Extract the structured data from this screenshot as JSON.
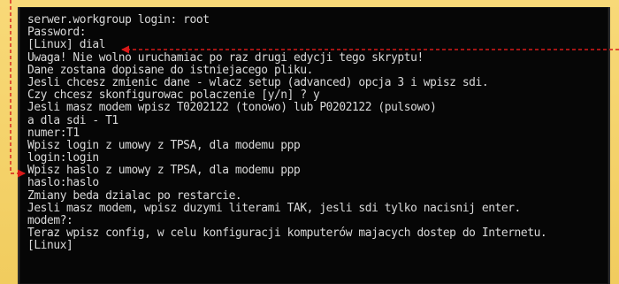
{
  "terminal": {
    "lines": [
      "serwer.workgroup login: root",
      "Password:",
      "[Linux] dial",
      "Uwaga! Nie wolno uruchamiac po raz drugi edycji tego skryptu!",
      "Dane zostana dopisane do istniejacego pliku.",
      "Jesli chcesz zmienic dane - wlacz setup (advanced) opcja 3 i wpisz sdi.",
      "Czy chcesz skonfigurowac polaczenie [y/n] ? y",
      "Jesli masz modem wpisz T0202122 (tonowo) lub P0202122 (pulsowo)",
      "a dla sdi - T1",
      "numer:T1",
      "Wpisz login z umowy z TPSA, dla modemu ppp",
      "login:login",
      "Wpisz haslo z umowy z TPSA, dla modemu ppp",
      "haslo:haslo",
      "Zmiany beda dzialac po restarcie.",
      "Jesli masz modem, wpisz duzymi literami TAK, jesli sdi tylko nacisnij enter.",
      "modem?:",
      "Teraz wpisz config, w celu konfiguracji komputerów majacych dostep do Internetu.",
      "[Linux]"
    ]
  },
  "colors": {
    "background": "#f5d36a",
    "terminal": "#060606",
    "terminal_text": "#d9d9d9",
    "annotation": "#d81919"
  }
}
